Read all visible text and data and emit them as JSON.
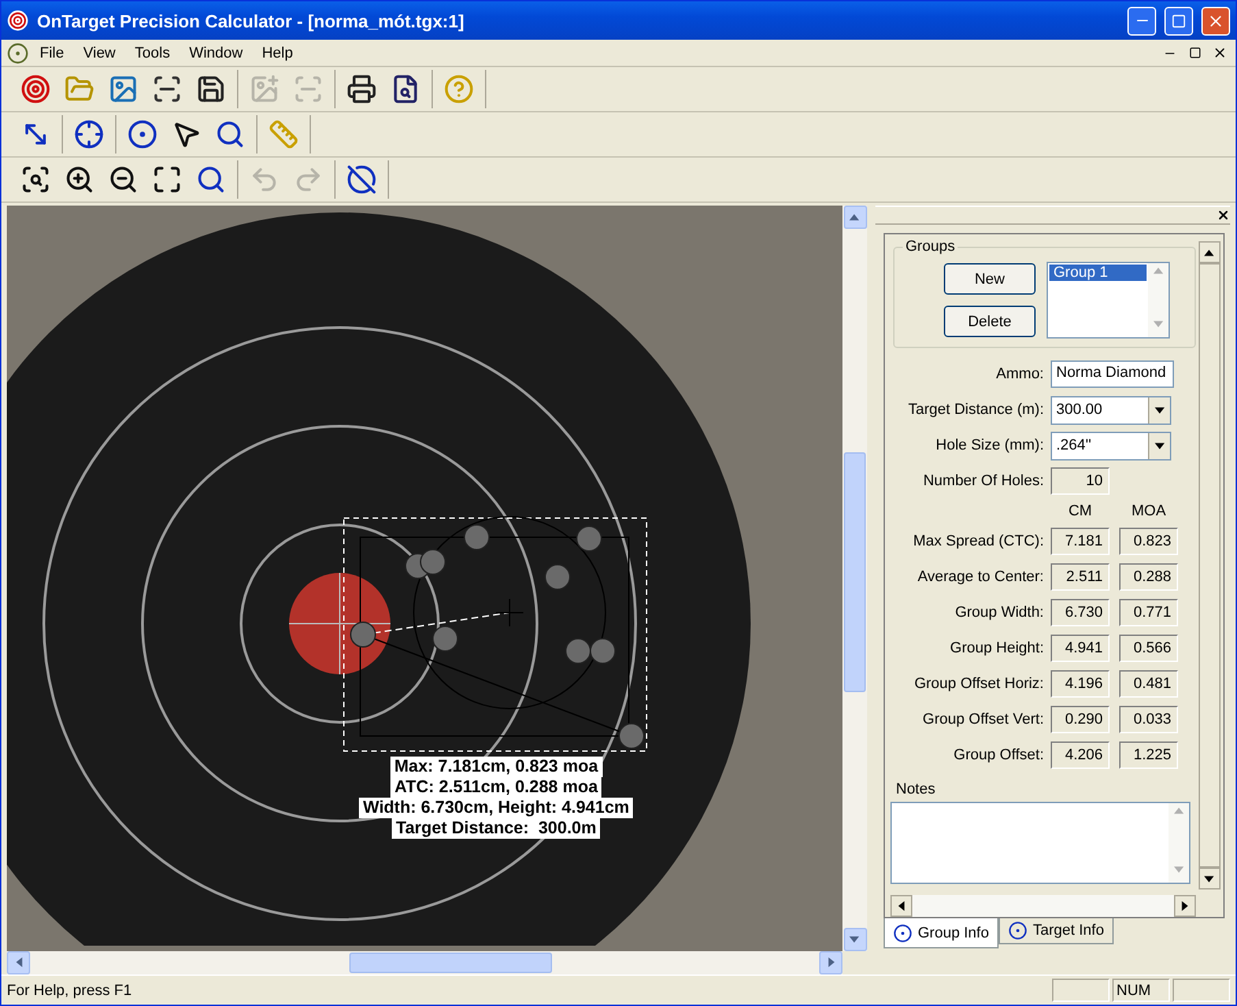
{
  "window": {
    "title": "OnTarget Precision Calculator - [norma_mót.tgx:1]"
  },
  "menu": [
    "File",
    "View",
    "Tools",
    "Window",
    "Help"
  ],
  "toolbars": [
    [
      [
        {
          "kind": "new-target",
          "disabled": false
        },
        {
          "kind": "open-folder",
          "disabled": false
        },
        {
          "kind": "open-image",
          "disabled": false
        },
        {
          "kind": "scanner",
          "disabled": false
        },
        {
          "kind": "save",
          "disabled": false
        }
      ],
      [
        {
          "kind": "add-image",
          "disabled": true
        },
        {
          "kind": "add-scan",
          "disabled": true
        }
      ],
      [
        {
          "kind": "print",
          "disabled": false
        },
        {
          "kind": "print-preview",
          "disabled": false
        }
      ],
      [
        {
          "kind": "help",
          "disabled": false
        }
      ]
    ],
    [
      [
        {
          "kind": "measure",
          "disabled": false
        }
      ],
      [
        {
          "kind": "center",
          "disabled": false
        }
      ],
      [
        {
          "kind": "group",
          "disabled": false
        },
        {
          "kind": "select",
          "disabled": false
        },
        {
          "kind": "hole",
          "disabled": false
        }
      ],
      [
        {
          "kind": "ruler",
          "disabled": false
        }
      ]
    ],
    [
      [
        {
          "kind": "zoom-area",
          "disabled": false
        },
        {
          "kind": "zoom-in",
          "disabled": false
        },
        {
          "kind": "zoom-out",
          "disabled": false
        },
        {
          "kind": "zoom-fit",
          "disabled": false
        },
        {
          "kind": "zoom-group",
          "disabled": false
        }
      ],
      [
        {
          "kind": "undo",
          "disabled": true
        },
        {
          "kind": "redo",
          "disabled": true
        }
      ],
      [
        {
          "kind": "no-target",
          "disabled": false
        }
      ]
    ]
  ],
  "canvas": {
    "overlay_lines": [
      "Max: 7.181cm, 0.823 moa",
      "ATC: 2.511cm, 0.288 moa",
      "Width: 6.730cm, Height: 4.941cm",
      "Target Distance:  300.0m"
    ]
  },
  "panel": {
    "groups": {
      "title": "Groups",
      "buttons": [
        "New",
        "Delete"
      ],
      "items": [
        {
          "label": "Group 1",
          "selected": true
        }
      ]
    },
    "fields": [
      {
        "kind": "text",
        "label": "Ammo:",
        "value": "Norma Diamond"
      },
      {
        "kind": "dropdown",
        "label": "Target Distance (m):",
        "value": "300.00"
      },
      {
        "kind": "dropdown",
        "label": "Hole Size (mm):",
        "value": ".264''"
      },
      {
        "kind": "readonly",
        "label": "Number Of Holes:",
        "value": "10"
      }
    ],
    "stats_columns": [
      "CM",
      "MOA"
    ],
    "stats": [
      {
        "label": "Max Spread (CTC):",
        "cm": "7.181",
        "moa": "0.823"
      },
      {
        "label": "Average to Center:",
        "cm": "2.511",
        "moa": "0.288"
      },
      {
        "label": "Group Width:",
        "cm": "6.730",
        "moa": "0.771"
      },
      {
        "label": "Group Height:",
        "cm": "4.941",
        "moa": "0.566"
      },
      {
        "label": "Group Offset Horiz:",
        "cm": "4.196",
        "moa": "0.481"
      },
      {
        "label": "Group Offset Vert:",
        "cm": "0.290",
        "moa": "0.033"
      },
      {
        "label": "Group Offset:",
        "cm": "4.206",
        "moa": "1.225"
      }
    ],
    "notes_label": "Notes",
    "tabs": [
      {
        "label": "Group Info",
        "selected": true
      },
      {
        "label": "Target Info",
        "selected": false
      }
    ]
  },
  "status_bar": {
    "text": "For Help, press F1",
    "indicators": [
      "NUM"
    ]
  }
}
